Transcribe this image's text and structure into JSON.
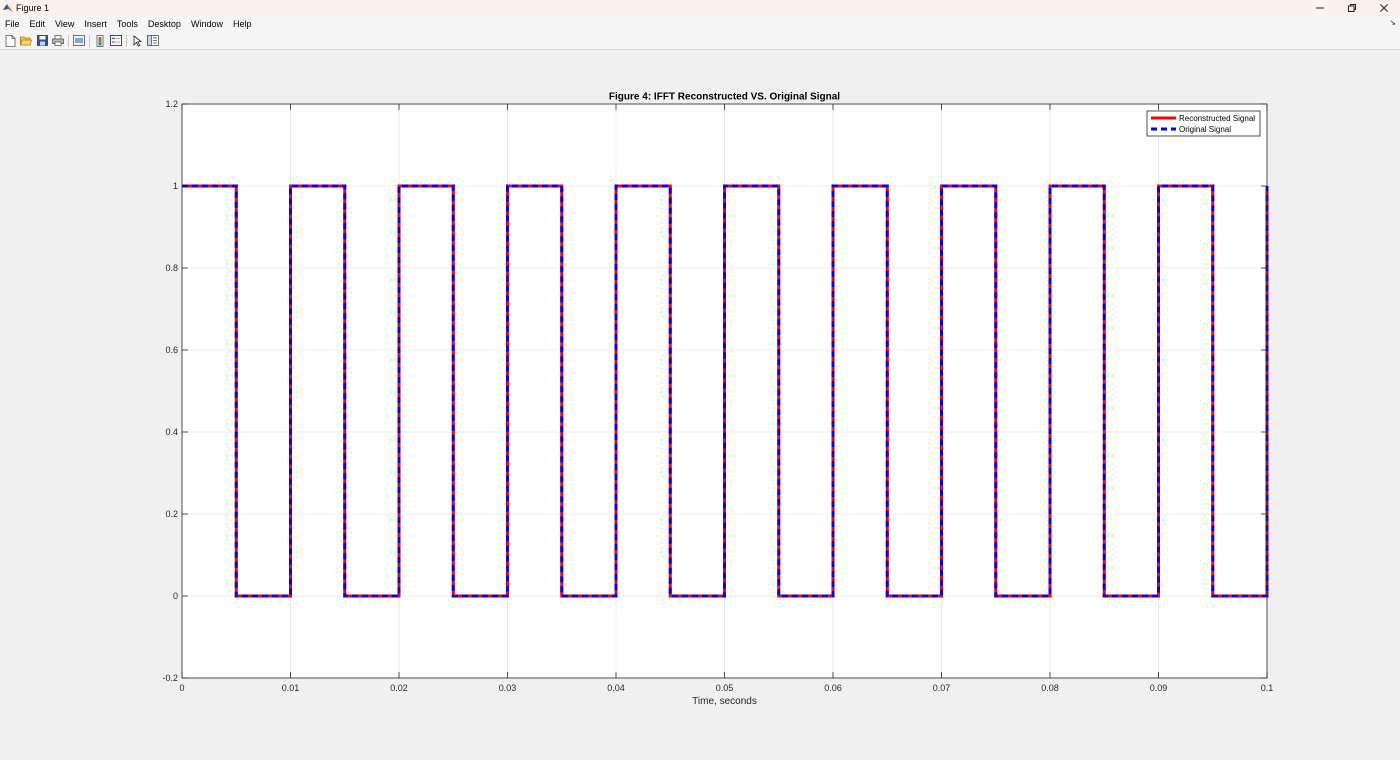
{
  "window": {
    "title": "Figure 1",
    "controls": [
      "minimize",
      "restore",
      "close"
    ]
  },
  "menu": [
    "File",
    "Edit",
    "View",
    "Insert",
    "Tools",
    "Desktop",
    "Window",
    "Help"
  ],
  "toolbar": {
    "icons": [
      "new-figure-icon",
      "open-file-icon",
      "save-icon",
      "print-icon",
      "link-plot-icon",
      "colorbar-icon",
      "legend-icon",
      "edit-plot-icon",
      "property-inspector-icon"
    ]
  },
  "colors": {
    "reconstructed": "#ff0000",
    "original": "#0000ff",
    "grid": "#e6e6e6",
    "axes": "#262626"
  },
  "chart_data": {
    "type": "line",
    "title": "Figure 4: IFFT Reconstructed VS. Original Signal",
    "xlabel": "Time, seconds",
    "ylabel": "",
    "xlim": [
      0,
      0.1
    ],
    "ylim": [
      -0.2,
      1.2
    ],
    "xticks": [
      0,
      0.01,
      0.02,
      0.03,
      0.04,
      0.05,
      0.06,
      0.07,
      0.08,
      0.09,
      0.1
    ],
    "xtick_labels": [
      "0",
      "0.01",
      "0.02",
      "0.03",
      "0.04",
      "0.05",
      "0.06",
      "0.07",
      "0.08",
      "0.09",
      "0.1"
    ],
    "yticks": [
      -0.2,
      0,
      0.2,
      0.4,
      0.6,
      0.8,
      1,
      1.2
    ],
    "ytick_labels": [
      "-0.2",
      "0",
      "0.2",
      "0.4",
      "0.6",
      "0.8",
      "1",
      "1.2"
    ],
    "grid": true,
    "legend_position": "top-right",
    "series": [
      {
        "name": "Reconstructed Signal",
        "style": "solid",
        "x": [
          0,
          0.005,
          0.005,
          0.01,
          0.01,
          0.015,
          0.015,
          0.02,
          0.02,
          0.025,
          0.025,
          0.03,
          0.03,
          0.035,
          0.035,
          0.04,
          0.04,
          0.045,
          0.045,
          0.05,
          0.05,
          0.055,
          0.055,
          0.06,
          0.06,
          0.065,
          0.065,
          0.07,
          0.07,
          0.075,
          0.075,
          0.08,
          0.08,
          0.085,
          0.085,
          0.09,
          0.09,
          0.095,
          0.095,
          0.1,
          0.1
        ],
        "y": [
          1,
          1,
          0,
          0,
          1,
          1,
          0,
          0,
          1,
          1,
          0,
          0,
          1,
          1,
          0,
          0,
          1,
          1,
          0,
          0,
          1,
          1,
          0,
          0,
          1,
          1,
          0,
          0,
          1,
          1,
          0,
          0,
          1,
          1,
          0,
          0,
          1,
          1,
          0,
          0,
          1
        ]
      },
      {
        "name": "Original Signal",
        "style": "dashed",
        "x": [
          0,
          0.005,
          0.005,
          0.01,
          0.01,
          0.015,
          0.015,
          0.02,
          0.02,
          0.025,
          0.025,
          0.03,
          0.03,
          0.035,
          0.035,
          0.04,
          0.04,
          0.045,
          0.045,
          0.05,
          0.05,
          0.055,
          0.055,
          0.06,
          0.06,
          0.065,
          0.065,
          0.07,
          0.07,
          0.075,
          0.075,
          0.08,
          0.08,
          0.085,
          0.085,
          0.09,
          0.09,
          0.095,
          0.095,
          0.1,
          0.1
        ],
        "y": [
          1,
          1,
          0,
          0,
          1,
          1,
          0,
          0,
          1,
          1,
          0,
          0,
          1,
          1,
          0,
          0,
          1,
          1,
          0,
          0,
          1,
          1,
          0,
          0,
          1,
          1,
          0,
          0,
          1,
          1,
          0,
          0,
          1,
          1,
          0,
          0,
          1,
          1,
          0,
          0,
          1
        ]
      }
    ]
  }
}
